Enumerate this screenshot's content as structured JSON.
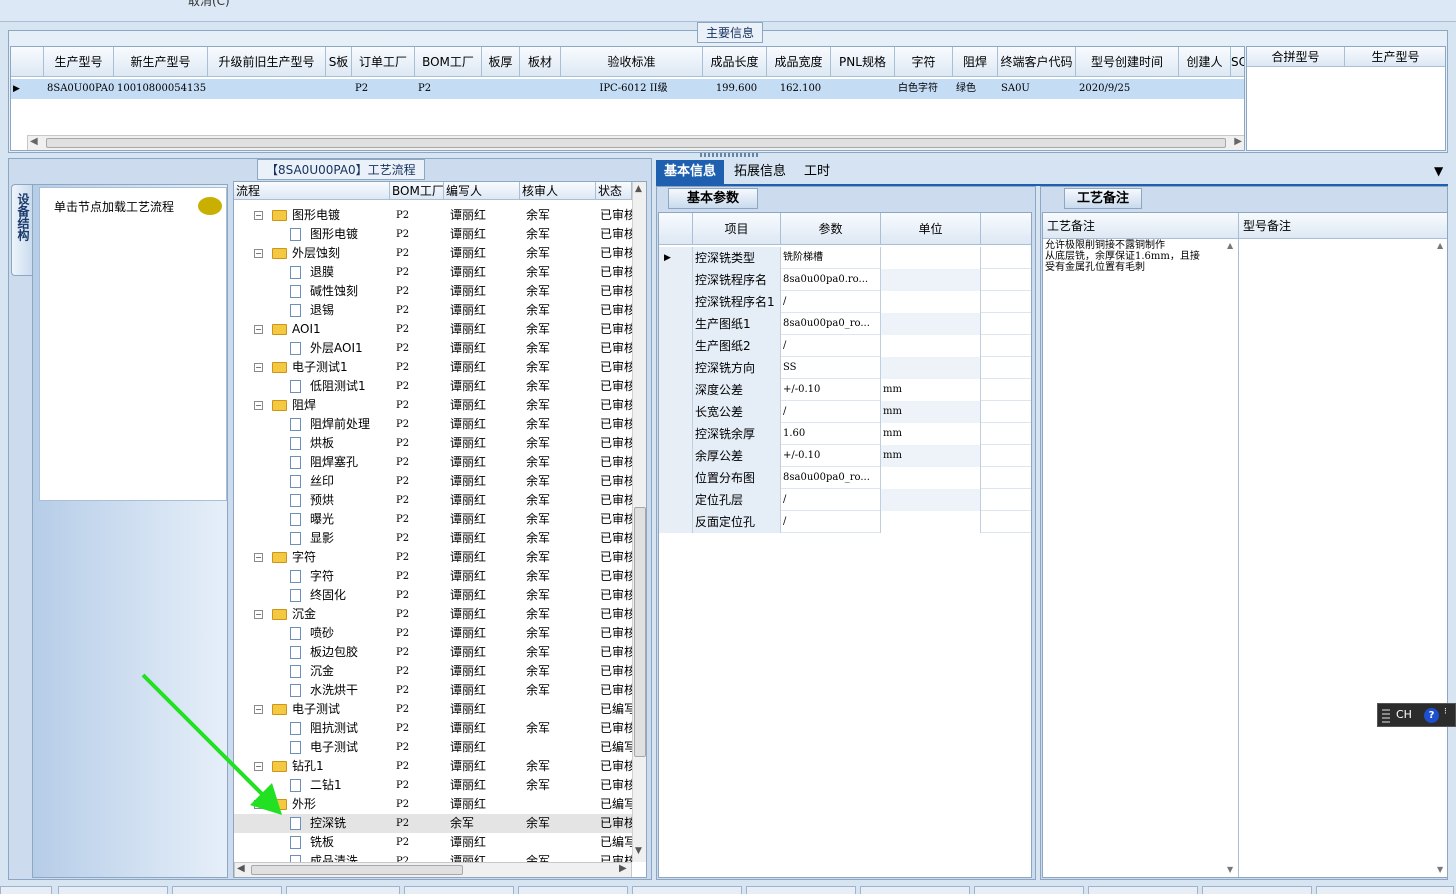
{
  "top": {
    "cut_text": "取消(C)"
  },
  "main_info": {
    "title": "主要信息",
    "columns": [
      "生产型号",
      "新生产型号",
      "升级前旧生产型号",
      "S板",
      "订单工厂",
      "BOM工厂",
      "板厚",
      "板材",
      "验收标准",
      "成品长度",
      "成品宽度",
      "PNL规格",
      "字符",
      "阻焊",
      "终端客户代码",
      "型号创建时间",
      "创建人",
      "SC"
    ],
    "row": [
      "8SA0U00PA0",
      "10010800054135",
      "",
      "",
      "P2",
      "P2",
      "",
      "",
      "IPC-6012 II级",
      "199.600",
      "162.100",
      "",
      "白色字符",
      "绿色",
      "SA0U",
      "2020/9/25",
      "",
      ""
    ],
    "row_marker": "▶"
  },
  "merge_panel": {
    "col1": "合拼型号",
    "col2": "生产型号"
  },
  "flow": {
    "title": "【8SA0U00PA0】工艺流程",
    "vertical_tab": "设备结构",
    "load_text": "单击节点加载工艺流程",
    "columns": [
      "流程",
      "BOM工厂",
      "编写人",
      "核审人",
      "状态"
    ],
    "rows": [
      {
        "level": 0,
        "type": "folder",
        "name": "图形电镀",
        "bom": "P2",
        "writer": "谭丽红",
        "reviewer": "余军",
        "status": "已审核"
      },
      {
        "level": 1,
        "type": "doc",
        "name": "图形电镀",
        "bom": "P2",
        "writer": "谭丽红",
        "reviewer": "余军",
        "status": "已审核"
      },
      {
        "level": 0,
        "type": "folder",
        "name": "外层蚀刻",
        "bom": "P2",
        "writer": "谭丽红",
        "reviewer": "余军",
        "status": "已审核"
      },
      {
        "level": 1,
        "type": "doc",
        "name": "退膜",
        "bom": "P2",
        "writer": "谭丽红",
        "reviewer": "余军",
        "status": "已审核"
      },
      {
        "level": 1,
        "type": "doc",
        "name": "碱性蚀刻",
        "bom": "P2",
        "writer": "谭丽红",
        "reviewer": "余军",
        "status": "已审核"
      },
      {
        "level": 1,
        "type": "doc",
        "name": "退锡",
        "bom": "P2",
        "writer": "谭丽红",
        "reviewer": "余军",
        "status": "已审核"
      },
      {
        "level": 0,
        "type": "folder",
        "name": "AOI1",
        "bom": "P2",
        "writer": "谭丽红",
        "reviewer": "余军",
        "status": "已审核"
      },
      {
        "level": 1,
        "type": "doc",
        "name": "外层AOI1",
        "bom": "P2",
        "writer": "谭丽红",
        "reviewer": "余军",
        "status": "已审核"
      },
      {
        "level": 0,
        "type": "folder",
        "name": "电子测试1",
        "bom": "P2",
        "writer": "谭丽红",
        "reviewer": "余军",
        "status": "已审核"
      },
      {
        "level": 1,
        "type": "doc",
        "name": "低阻测试1",
        "bom": "P2",
        "writer": "谭丽红",
        "reviewer": "余军",
        "status": "已审核"
      },
      {
        "level": 0,
        "type": "folder",
        "name": "阻焊",
        "bom": "P2",
        "writer": "谭丽红",
        "reviewer": "余军",
        "status": "已审核"
      },
      {
        "level": 1,
        "type": "doc",
        "name": "阻焊前处理",
        "bom": "P2",
        "writer": "谭丽红",
        "reviewer": "余军",
        "status": "已审核"
      },
      {
        "level": 1,
        "type": "doc",
        "name": "烘板",
        "bom": "P2",
        "writer": "谭丽红",
        "reviewer": "余军",
        "status": "已审核"
      },
      {
        "level": 1,
        "type": "doc",
        "name": "阻焊塞孔",
        "bom": "P2",
        "writer": "谭丽红",
        "reviewer": "余军",
        "status": "已审核"
      },
      {
        "level": 1,
        "type": "doc",
        "name": "丝印",
        "bom": "P2",
        "writer": "谭丽红",
        "reviewer": "余军",
        "status": "已审核"
      },
      {
        "level": 1,
        "type": "doc",
        "name": "预烘",
        "bom": "P2",
        "writer": "谭丽红",
        "reviewer": "余军",
        "status": "已审核"
      },
      {
        "level": 1,
        "type": "doc",
        "name": "曝光",
        "bom": "P2",
        "writer": "谭丽红",
        "reviewer": "余军",
        "status": "已审核"
      },
      {
        "level": 1,
        "type": "doc",
        "name": "显影",
        "bom": "P2",
        "writer": "谭丽红",
        "reviewer": "余军",
        "status": "已审核"
      },
      {
        "level": 0,
        "type": "folder",
        "name": "字符",
        "bom": "P2",
        "writer": "谭丽红",
        "reviewer": "余军",
        "status": "已审核"
      },
      {
        "level": 1,
        "type": "doc",
        "name": "字符",
        "bom": "P2",
        "writer": "谭丽红",
        "reviewer": "余军",
        "status": "已审核"
      },
      {
        "level": 1,
        "type": "doc",
        "name": "终固化",
        "bom": "P2",
        "writer": "谭丽红",
        "reviewer": "余军",
        "status": "已审核"
      },
      {
        "level": 0,
        "type": "folder",
        "name": "沉金",
        "bom": "P2",
        "writer": "谭丽红",
        "reviewer": "余军",
        "status": "已审核"
      },
      {
        "level": 1,
        "type": "doc",
        "name": "喷砂",
        "bom": "P2",
        "writer": "谭丽红",
        "reviewer": "余军",
        "status": "已审核"
      },
      {
        "level": 1,
        "type": "doc",
        "name": "板边包胶",
        "bom": "P2",
        "writer": "谭丽红",
        "reviewer": "余军",
        "status": "已审核"
      },
      {
        "level": 1,
        "type": "doc",
        "name": "沉金",
        "bom": "P2",
        "writer": "谭丽红",
        "reviewer": "余军",
        "status": "已审核"
      },
      {
        "level": 1,
        "type": "doc",
        "name": "水洗烘干",
        "bom": "P2",
        "writer": "谭丽红",
        "reviewer": "余军",
        "status": "已审核"
      },
      {
        "level": 0,
        "type": "folder",
        "name": "电子测试",
        "bom": "P2",
        "writer": "谭丽红",
        "reviewer": "",
        "status": "已编写"
      },
      {
        "level": 1,
        "type": "doc",
        "name": "阻抗测试",
        "bom": "P2",
        "writer": "谭丽红",
        "reviewer": "余军",
        "status": "已审核"
      },
      {
        "level": 1,
        "type": "doc",
        "name": "电子测试",
        "bom": "P2",
        "writer": "谭丽红",
        "reviewer": "",
        "status": "已编写"
      },
      {
        "level": 0,
        "type": "folder",
        "name": "钻孔1",
        "bom": "P2",
        "writer": "谭丽红",
        "reviewer": "余军",
        "status": "已审核"
      },
      {
        "level": 1,
        "type": "doc",
        "name": "二钻1",
        "bom": "P2",
        "writer": "谭丽红",
        "reviewer": "余军",
        "status": "已审核"
      },
      {
        "level": 0,
        "type": "folder",
        "name": "外形",
        "bom": "P2",
        "writer": "谭丽红",
        "reviewer": "",
        "status": "已编写"
      },
      {
        "level": 1,
        "type": "doc",
        "name": "控深铣",
        "bom": "P2",
        "writer": "余军",
        "reviewer": "余军",
        "status": "已审核",
        "selected": true
      },
      {
        "level": 1,
        "type": "doc",
        "name": "铣板",
        "bom": "P2",
        "writer": "谭丽红",
        "reviewer": "",
        "status": "已编写"
      },
      {
        "level": 1,
        "type": "doc",
        "name": "成品清洗",
        "bom": "P2",
        "writer": "谭丽红",
        "reviewer": "余军",
        "status": "已审核"
      }
    ]
  },
  "tabs": {
    "basic": "基本信息",
    "extended": "拓展信息",
    "hours": "工时"
  },
  "basic_params": {
    "title": "基本参数",
    "columns": [
      "项目",
      "参数",
      "单位"
    ],
    "rows": [
      {
        "item": "控深铣类型",
        "value": "铣阶梯槽",
        "unit": ""
      },
      {
        "item": "控深铣程序名",
        "value": "8sa0u00pa0.ro...",
        "unit": ""
      },
      {
        "item": "控深铣程序名1",
        "value": "/",
        "unit": ""
      },
      {
        "item": "生产图纸1",
        "value": "8sa0u00pa0_ro...",
        "unit": ""
      },
      {
        "item": "生产图纸2",
        "value": "/",
        "unit": ""
      },
      {
        "item": "控深铣方向",
        "value": "SS",
        "unit": ""
      },
      {
        "item": "深度公差",
        "value": "+/-0.10",
        "unit": "mm"
      },
      {
        "item": "长宽公差",
        "value": "/",
        "unit": "mm"
      },
      {
        "item": "控深铣余厚",
        "value": "1.60",
        "unit": "mm"
      },
      {
        "item": "余厚公差",
        "value": "+/-0.10",
        "unit": "mm"
      },
      {
        "item": "位置分布图",
        "value": "8sa0u00pa0_ro...",
        "unit": ""
      },
      {
        "item": "定位孔层",
        "value": "/",
        "unit": ""
      },
      {
        "item": "反面定位孔",
        "value": "/",
        "unit": ""
      }
    ]
  },
  "process_notes": {
    "title": "工艺备注",
    "col1": "工艺备注",
    "col2": "型号备注",
    "note_line1": "允许极限削铜接不露铜制作",
    "note_line2": "从底层铣，余厚保证1.6mm，且接",
    "note_line3": "受有金属孔位置有毛刺"
  },
  "ime": {
    "label": "CH"
  },
  "colors": {
    "accent": "#1f5fb0",
    "selected_row": "#c5dcf5",
    "arrow": "#22e022"
  }
}
